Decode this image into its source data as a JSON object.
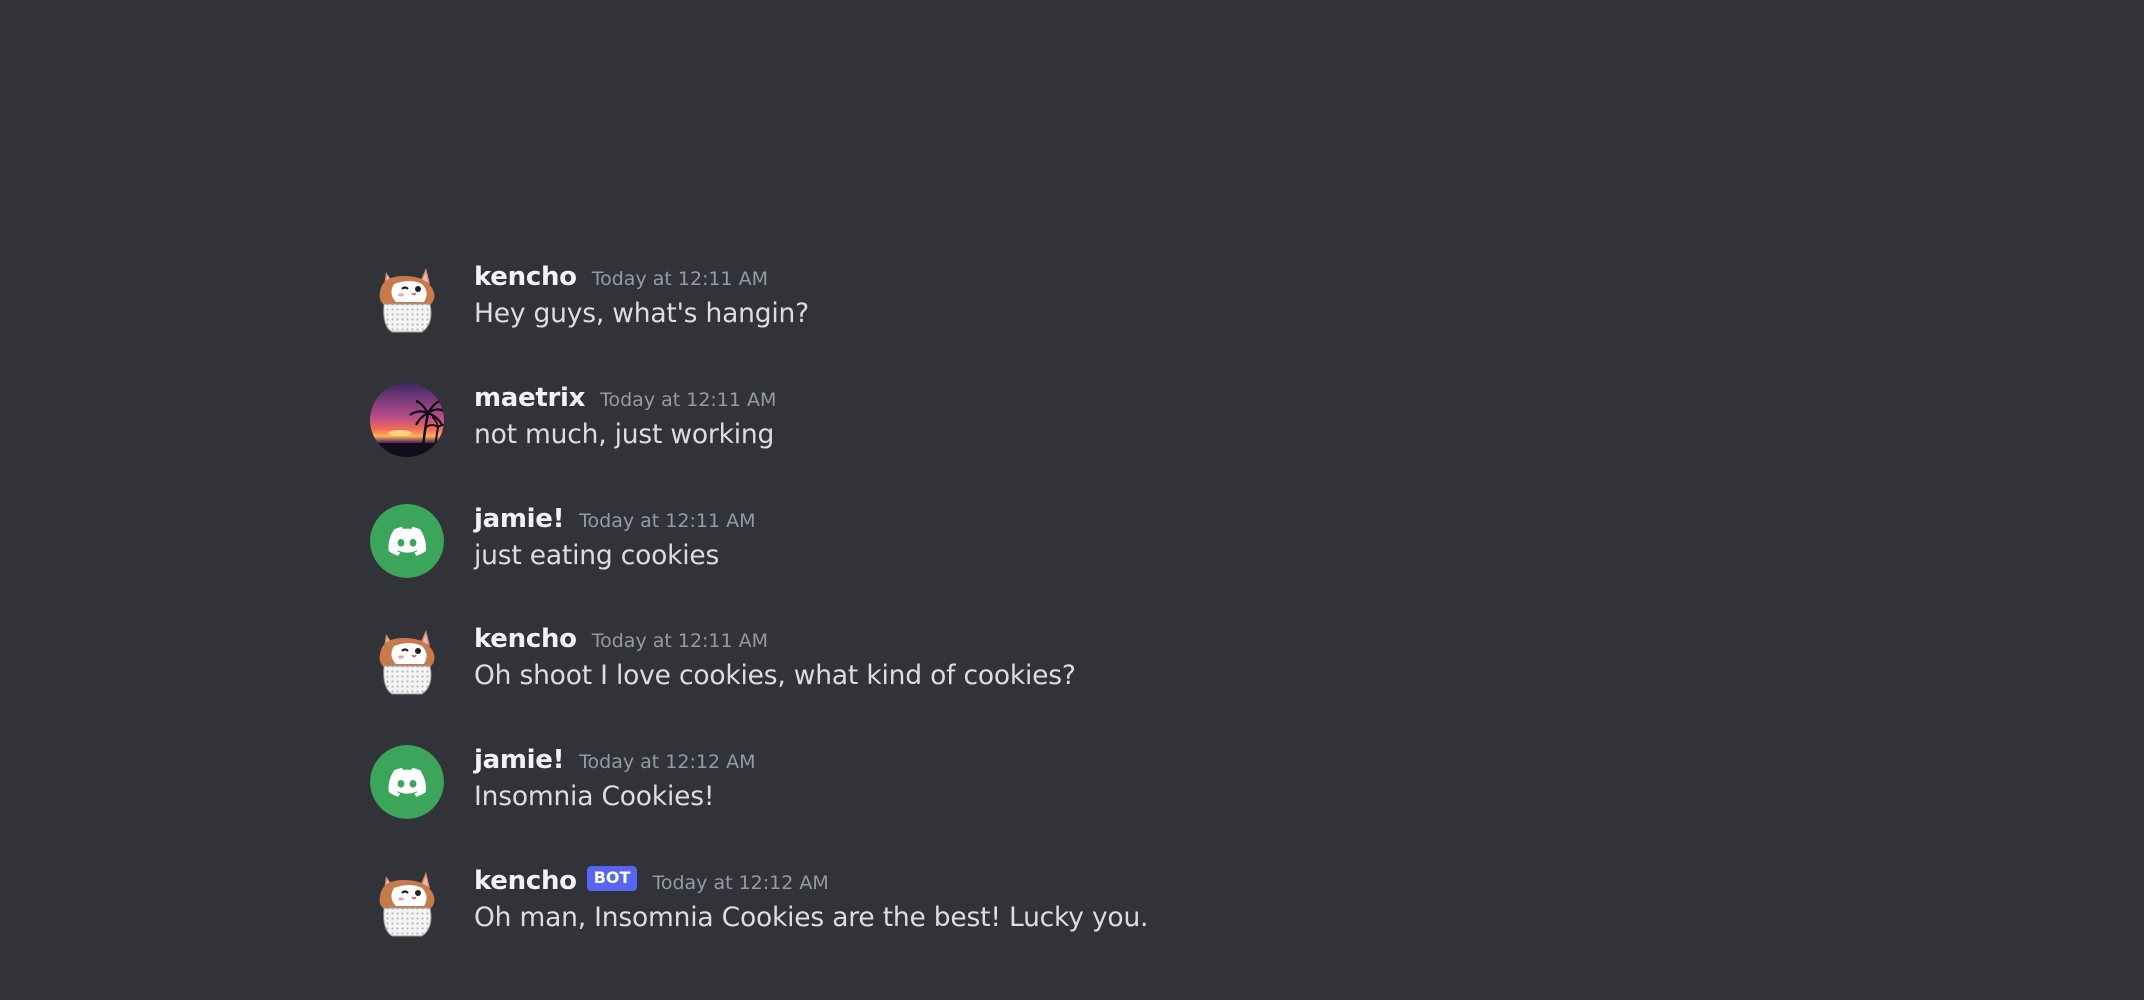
{
  "theme": {
    "background": "#313338",
    "username_color": "#f2f3f5",
    "text_color": "#dbdee1",
    "timestamp_color": "#949ba4",
    "bot_tag_color": "#5865f2",
    "discord_avatar_green": "#3ba55c"
  },
  "messages": [
    {
      "avatar": "hamster-avatar-icon",
      "username": "kencho",
      "timestamp": "Today at 12:11 AM",
      "text": "Hey guys, what's hangin?"
    },
    {
      "avatar": "sunset-palm-avatar-icon",
      "username": "maetrix",
      "timestamp": "Today at 12:11 AM",
      "text": "not much, just working"
    },
    {
      "avatar": "discord-logo-avatar-icon",
      "username": "jamie!",
      "timestamp": "Today at 12:11 AM",
      "text": "just eating cookies"
    },
    {
      "avatar": "hamster-avatar-icon",
      "username": "kencho",
      "timestamp": "Today at 12:11 AM",
      "text": "Oh shoot I love cookies, what kind of cookies?"
    },
    {
      "avatar": "discord-logo-avatar-icon",
      "username": "jamie!",
      "timestamp": "Today at 12:12 AM",
      "text": "Insomnia Cookies!"
    },
    {
      "avatar": "hamster-avatar-icon",
      "username": "kencho",
      "bot_tag": "BOT",
      "timestamp": "Today at 12:12 AM",
      "text": "Oh man, Insomnia Cookies are the best! Lucky you."
    }
  ]
}
